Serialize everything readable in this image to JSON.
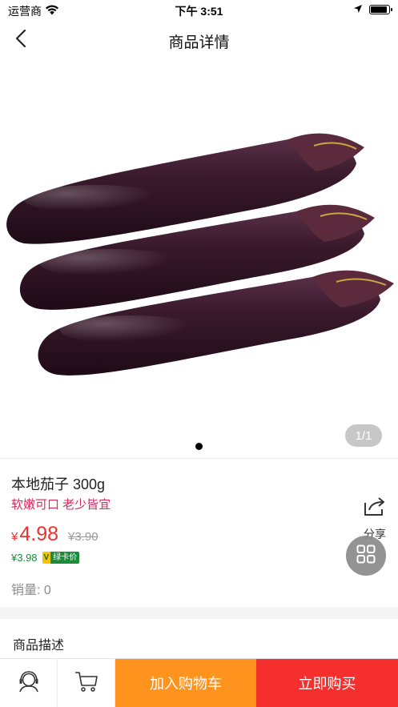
{
  "status_bar": {
    "carrier": "运营商",
    "time": "下午 3:51",
    "battery_level": 0.92
  },
  "nav": {
    "title": "商品详情",
    "back_icon": "chevron-left-icon"
  },
  "gallery": {
    "image_alt": "eggplant-photo",
    "counter": "1/1",
    "page_count": 1,
    "active_page": 1
  },
  "product": {
    "name": "本地茄子 300g",
    "subtitle": "软嫩可口 老少皆宜",
    "price_symbol": "¥",
    "price": "4.98",
    "original_price": "¥3.90",
    "member_price": "¥3.98",
    "member_badge_v": "V",
    "member_badge_text": "绿卡价",
    "sales": "销量:  0"
  },
  "share": {
    "label": "分享",
    "icon": "share-icon"
  },
  "fab": {
    "icon": "grid-icon"
  },
  "description": {
    "title": "商品描述"
  },
  "bottom_bar": {
    "service_icon": "customer-service-icon",
    "cart_icon": "cart-icon",
    "add_to_cart": "加入购物车",
    "buy_now": "立即购买"
  },
  "colors": {
    "price_red": "#f23030",
    "subtitle_pink": "#e0245e",
    "member_green": "#1b8a3a",
    "add_to_cart_orange": "#ff931e",
    "buy_now_red": "#f52e2e"
  }
}
